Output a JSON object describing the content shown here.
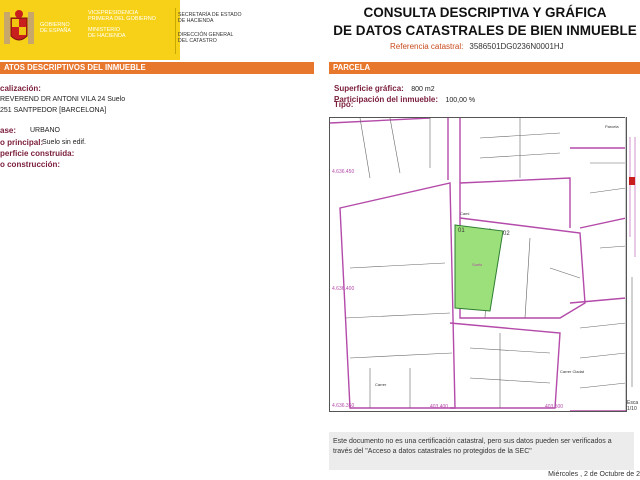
{
  "header": {
    "government": [
      "GOBIERNO",
      "DE ESPAÑA"
    ],
    "ministry_1": [
      "VICEPRESIDENCIA",
      "PRIMERA DEL GOBIERNO"
    ],
    "ministry_2": [
      "MINISTERIO",
      "DE HACIENDA"
    ],
    "secretariat": [
      "SECRETARÍA DE ESTADO",
      "DE HACIENDA"
    ],
    "directorate": [
      "DIRECCIÓN GENERAL",
      "DEL CATASTRO"
    ]
  },
  "title": [
    "CONSULTA DESCRIPTIVA Y GRÁFICA",
    "DE DATOS CATASTRALES DE BIEN INMUEBLE"
  ],
  "reference": {
    "label": "Referencia catastral:",
    "value": "3586501DG0236N0001HJ"
  },
  "left_panel": {
    "heading": "ATOS DESCRIPTIVOS DEL INMUEBLE",
    "location_label": "calización:",
    "address_line1": "REVEREND DR ANTONI VILA 24 Suelo",
    "address_line2": "251 SANTPEDOR [BARCELONA]",
    "class_label": "ase:",
    "class_value": "URBANO",
    "use_label": "o principal:",
    "use_value": "Suelo sin edif.",
    "built_label": "perficie construida:",
    "year_label": "o construcción:"
  },
  "parcel": {
    "heading": "PARCELA",
    "area_label": "Superficie gráfica:",
    "area_value": "800 m2",
    "share_label": "Participación del inmueble:",
    "share_value": "100,00 %",
    "type_label": "Tipo:"
  },
  "map": {
    "coords_left": [
      "4.636.450",
      "4.636.400",
      "4.636.350"
    ],
    "coords_bottom": [
      "403.400",
      "403.500"
    ],
    "parcel_numbers": [
      "01",
      "02"
    ],
    "parcel_tag": "Suelo",
    "streets": [
      "Cami",
      "Carrer",
      "Carrer Cladat"
    ],
    "legend_tag": "Parcela"
  },
  "scale": [
    "Esca",
    "1/10"
  ],
  "note": "Este documento no es una certificación catastral, pero sus datos pueden ser verificados a través del \"Acceso a datos catastrales no protegidos de la SEC\"",
  "date": "Miércoles , 2 de Octubre de 2",
  "colors": {
    "accent": "#e8772e",
    "label": "#7a1d3a",
    "parcel_fill": "#9be07a",
    "plot_lines": "#b44aa9",
    "flag_yellow": "#f7d117"
  }
}
